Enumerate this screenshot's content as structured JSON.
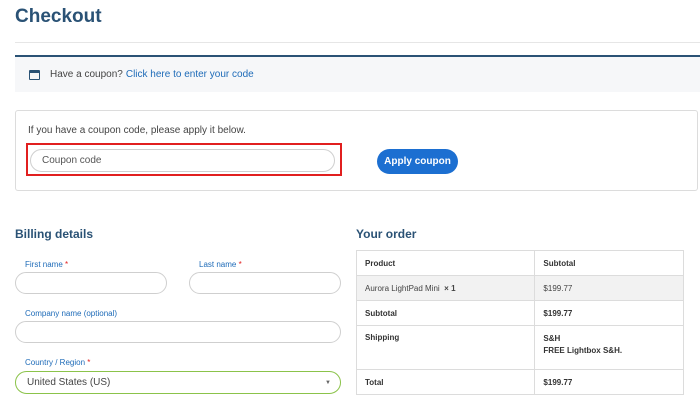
{
  "page": {
    "title": "Checkout"
  },
  "coupon_notice": {
    "prefix": "Have a coupon?",
    "link": "Click here to enter your code",
    "icon": "calendar-icon"
  },
  "coupon_form": {
    "hint": "If you have a coupon code, please apply it below.",
    "input_placeholder": "Coupon code",
    "apply_label": "Apply coupon",
    "highlight_color": "#e11f1f",
    "button_color": "#1c6fd1"
  },
  "billing": {
    "heading": "Billing details",
    "first_name_label": "First name",
    "last_name_label": "Last name",
    "company_label": "Company name (optional)",
    "country_label": "Country / Region",
    "required_mark": "*",
    "country_value": "United States (US)"
  },
  "order": {
    "heading": "Your order",
    "header_product": "Product",
    "header_subtotal": "Subtotal",
    "item_name": "Aurora LightPad Mini",
    "item_qty": "× 1",
    "item_price": "$199.77",
    "subtotal_label": "Subtotal",
    "subtotal_value": "$199.77",
    "shipping_label": "Shipping",
    "shipping_method": "S&H",
    "shipping_note": "FREE Lightbox S&H.",
    "total_label": "Total",
    "total_value": "$199.77"
  },
  "colors": {
    "heading": "#2a5275",
    "link": "#1e6bb8",
    "required": "#e11f1f",
    "valid_border": "#8bc34a"
  }
}
